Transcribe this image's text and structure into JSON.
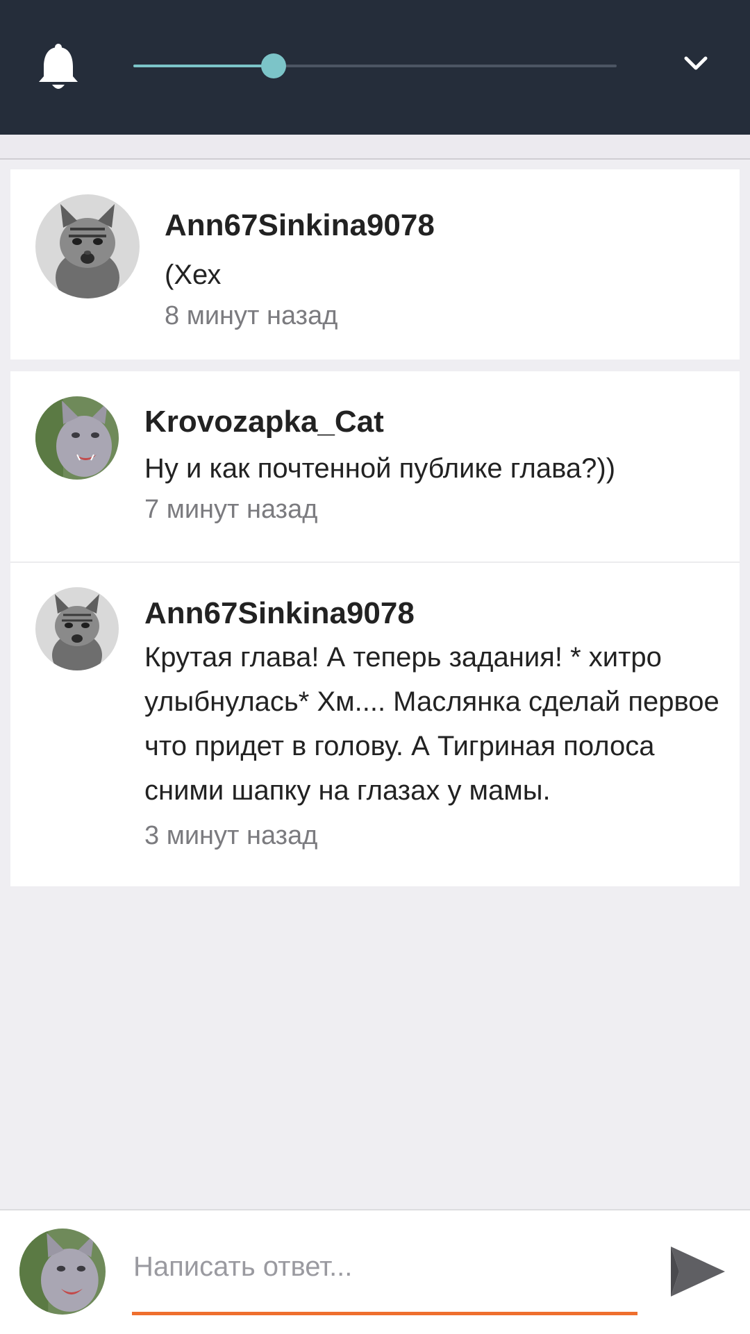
{
  "header": {
    "bell_icon": "bell-icon",
    "slider_value": 0.29,
    "collapse_icon": "chevron-down-icon"
  },
  "comments": [
    {
      "username": "Ann67Sinkina9078",
      "text": "(Хех",
      "time": "8 минут назад",
      "avatar": "tabby-kitten"
    },
    {
      "username": "Krovozapka_Cat",
      "text": "Ну и как почтенной публике глава?))",
      "time": "7 минут назад",
      "avatar": "grey-cat"
    },
    {
      "username": "Ann67Sinkina9078",
      "text": "Крутая глава! А теперь задания! * хитро улыбнулась* Хм.... Маслянка сделай первое что придет в голову. А Тигриная полоса сними шапку на глазах у мамы.",
      "time": "3 минут назад",
      "avatar": "tabby-kitten"
    }
  ],
  "reply": {
    "placeholder": "Написать ответ...",
    "send_icon": "send-icon"
  },
  "colors": {
    "header_bg": "#252d3a",
    "slider_accent": "#7cc4c8",
    "input_accent": "#ef6f2e"
  }
}
